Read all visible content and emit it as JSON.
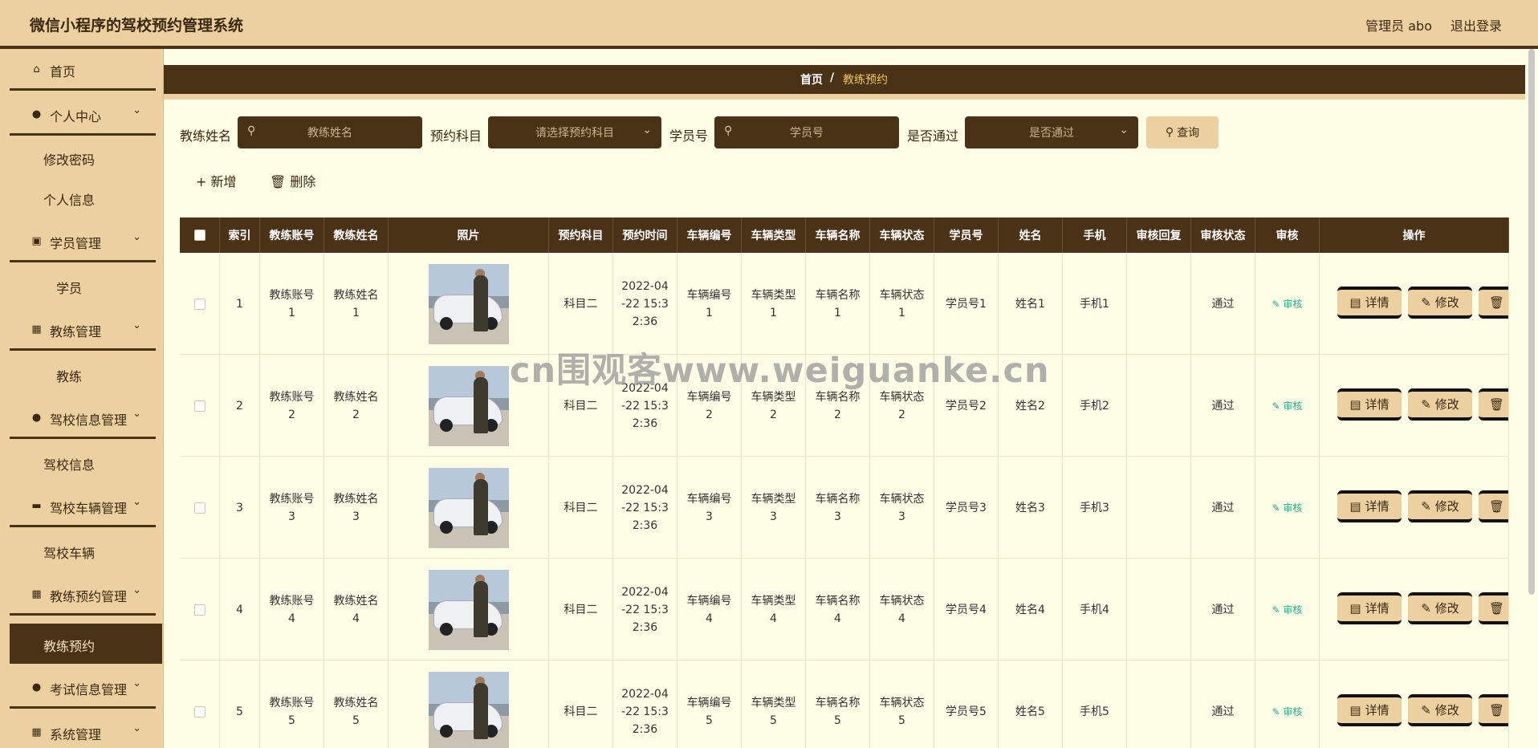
{
  "header": {
    "title": "微信小程序的驾校预约管理系统",
    "admin": "管理员 abo",
    "logout": "退出登录"
  },
  "sidebar": {
    "home": "首页",
    "personal": "个人中心",
    "change_password": "修改密码",
    "personal_info": "个人信息",
    "student_mgmt": "学员管理",
    "student": "学员",
    "coach_mgmt": "教练管理",
    "coach": "教练",
    "school_info_mgmt": "驾校信息管理",
    "school_info": "驾校信息",
    "vehicle_mgmt": "驾校车辆管理",
    "vehicle": "驾校车辆",
    "booking_mgmt": "教练预约管理",
    "booking": "教练预约",
    "exam_mgmt": "考试信息管理",
    "system_mgmt": "系统管理"
  },
  "breadcrumb": {
    "home": "首页",
    "sep": "/",
    "current": "教练预约"
  },
  "filters": {
    "coach_name_label": "教练姓名",
    "coach_name_placeholder": "教练姓名",
    "subject_label": "预约科目",
    "subject_placeholder": "请选择预约科目",
    "student_no_label": "学员号",
    "student_no_placeholder": "学员号",
    "passed_label": "是否通过",
    "passed_placeholder": "是否通过",
    "query": "查询"
  },
  "actions": {
    "add": "新增",
    "delete": "删除"
  },
  "table": {
    "headers": [
      "索引",
      "教练账号",
      "教练姓名",
      "照片",
      "预约科目",
      "预约时间",
      "车辆编号",
      "车辆类型",
      "车辆名称",
      "车辆状态",
      "学员号",
      "姓名",
      "手机",
      "审核回复",
      "审核状态",
      "审核",
      "操作"
    ],
    "audit_label": "审核",
    "detail_label": "详情",
    "edit_label": "修改",
    "rows": [
      {
        "idx": "1",
        "account": "教练账号1",
        "name": "教练姓名1",
        "subject": "科目二",
        "time": "2022-04-22 15:32:36",
        "vno": "车辆编号1",
        "vtype": "车辆类型1",
        "vname": "车辆名称1",
        "vstatus": "车辆状态1",
        "sno": "学员号1",
        "sname": "姓名1",
        "phone": "手机1",
        "reply": "",
        "status": "通过"
      },
      {
        "idx": "2",
        "account": "教练账号2",
        "name": "教练姓名2",
        "subject": "科目二",
        "time": "2022-04-22 15:32:36",
        "vno": "车辆编号2",
        "vtype": "车辆类型2",
        "vname": "车辆名称2",
        "vstatus": "车辆状态2",
        "sno": "学员号2",
        "sname": "姓名2",
        "phone": "手机2",
        "reply": "",
        "status": "通过"
      },
      {
        "idx": "3",
        "account": "教练账号3",
        "name": "教练姓名3",
        "subject": "科目二",
        "time": "2022-04-22 15:32:36",
        "vno": "车辆编号3",
        "vtype": "车辆类型3",
        "vname": "车辆名称3",
        "vstatus": "车辆状态3",
        "sno": "学员号3",
        "sname": "姓名3",
        "phone": "手机3",
        "reply": "",
        "status": "通过"
      },
      {
        "idx": "4",
        "account": "教练账号4",
        "name": "教练姓名4",
        "subject": "科目二",
        "time": "2022-04-22 15:32:36",
        "vno": "车辆编号4",
        "vtype": "车辆类型4",
        "vname": "车辆名称4",
        "vstatus": "车辆状态4",
        "sno": "学员号4",
        "sname": "姓名4",
        "phone": "手机4",
        "reply": "",
        "status": "通过"
      },
      {
        "idx": "5",
        "account": "教练账号5",
        "name": "教练姓名5",
        "subject": "科目二",
        "time": "2022-04-22 15:32:36",
        "vno": "车辆编号5",
        "vtype": "车辆类型5",
        "vname": "车辆名称5",
        "vstatus": "车辆状态5",
        "sno": "学员号5",
        "sname": "姓名5",
        "phone": "手机5",
        "reply": "",
        "status": "通过"
      }
    ]
  },
  "watermark": "cn围观客www.weiguanke.cn"
}
